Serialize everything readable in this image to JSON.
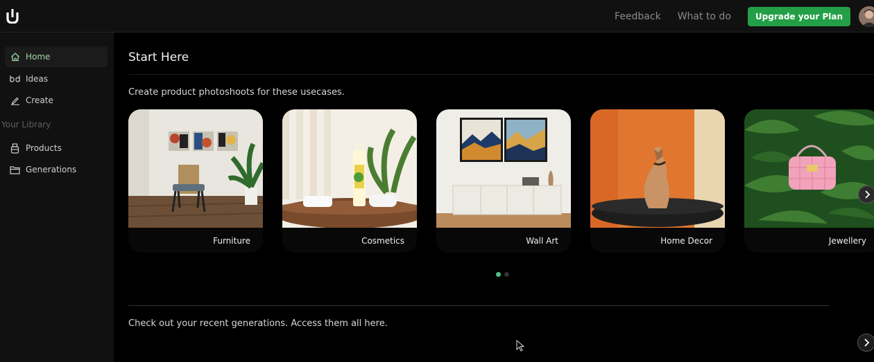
{
  "header": {
    "logo_icon": "u-logo-icon",
    "links": {
      "feedback": "Feedback",
      "what_to_do": "What to do"
    },
    "upgrade_label": "Upgrade your Plan",
    "accent_color": "#23a047"
  },
  "sidebar": {
    "items": [
      {
        "label": "Home",
        "icon": "home-icon",
        "active": true
      },
      {
        "label": "Ideas",
        "icon": "ideas-icon"
      },
      {
        "label": "Create",
        "icon": "pencil-icon"
      }
    ],
    "section_label": "Your Library",
    "library_items": [
      {
        "label": "Products",
        "icon": "product-icon"
      },
      {
        "label": "Generations",
        "icon": "folder-icon"
      }
    ]
  },
  "main": {
    "title": "Start Here",
    "subtitle": "Create product photoshoots for these usecases.",
    "cards": [
      {
        "label": "Furniture"
      },
      {
        "label": "Cosmetics"
      },
      {
        "label": "Wall Art"
      },
      {
        "label": "Home Decor"
      },
      {
        "label": "Jewellery"
      }
    ],
    "carousel": {
      "current_page": 1,
      "total_pages": 2
    },
    "recent_text": "Check out your recent generations. Access them all here."
  }
}
